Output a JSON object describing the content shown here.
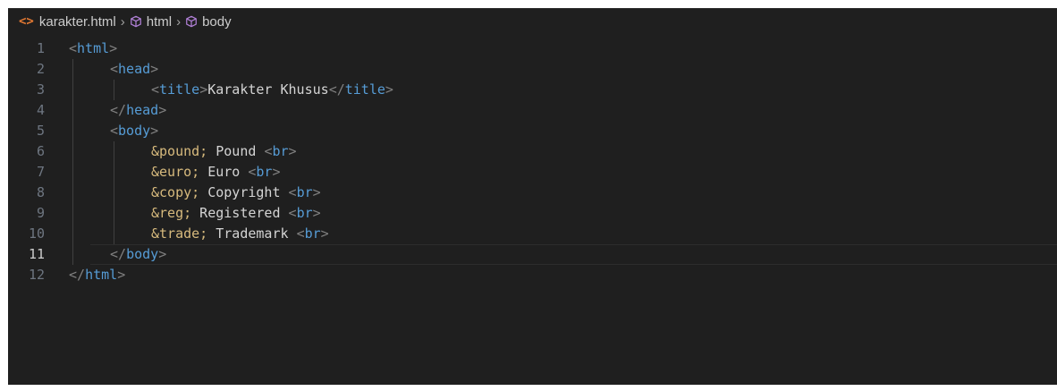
{
  "breadcrumb": {
    "file": "karakter.html",
    "items": [
      "html",
      "body"
    ]
  },
  "lines": [
    {
      "num": "1",
      "indent": 0,
      "tokens": [
        {
          "t": "<",
          "c": "bracket"
        },
        {
          "t": "html",
          "c": "tag-name"
        },
        {
          "t": ">",
          "c": "bracket"
        }
      ]
    },
    {
      "num": "2",
      "indent": 1,
      "tokens": [
        {
          "t": "<",
          "c": "bracket"
        },
        {
          "t": "head",
          "c": "tag-name"
        },
        {
          "t": ">",
          "c": "bracket"
        }
      ]
    },
    {
      "num": "3",
      "indent": 2,
      "tokens": [
        {
          "t": "<",
          "c": "bracket"
        },
        {
          "t": "title",
          "c": "tag-name"
        },
        {
          "t": ">",
          "c": "bracket"
        },
        {
          "t": "Karakter Khusus",
          "c": "plain"
        },
        {
          "t": "</",
          "c": "bracket"
        },
        {
          "t": "title",
          "c": "tag-name"
        },
        {
          "t": ">",
          "c": "bracket"
        }
      ]
    },
    {
      "num": "4",
      "indent": 1,
      "tokens": [
        {
          "t": "</",
          "c": "bracket"
        },
        {
          "t": "head",
          "c": "tag-name"
        },
        {
          "t": ">",
          "c": "bracket"
        }
      ]
    },
    {
      "num": "5",
      "indent": 1,
      "tokens": [
        {
          "t": "<",
          "c": "bracket"
        },
        {
          "t": "body",
          "c": "tag-name"
        },
        {
          "t": ">",
          "c": "bracket"
        }
      ]
    },
    {
      "num": "6",
      "indent": 2,
      "tokens": [
        {
          "t": "&pound;",
          "c": "ent"
        },
        {
          "t": " Pound ",
          "c": "plain"
        },
        {
          "t": "<",
          "c": "bracket"
        },
        {
          "t": "br",
          "c": "tag-name"
        },
        {
          "t": ">",
          "c": "bracket"
        }
      ]
    },
    {
      "num": "7",
      "indent": 2,
      "tokens": [
        {
          "t": "&euro;",
          "c": "ent"
        },
        {
          "t": " Euro ",
          "c": "plain"
        },
        {
          "t": "<",
          "c": "bracket"
        },
        {
          "t": "br",
          "c": "tag-name"
        },
        {
          "t": ">",
          "c": "bracket"
        }
      ]
    },
    {
      "num": "8",
      "indent": 2,
      "tokens": [
        {
          "t": "&copy;",
          "c": "ent"
        },
        {
          "t": " Copyright ",
          "c": "plain"
        },
        {
          "t": "<",
          "c": "bracket"
        },
        {
          "t": "br",
          "c": "tag-name"
        },
        {
          "t": ">",
          "c": "bracket"
        }
      ]
    },
    {
      "num": "9",
      "indent": 2,
      "tokens": [
        {
          "t": "&reg;",
          "c": "ent"
        },
        {
          "t": " Registered ",
          "c": "plain"
        },
        {
          "t": "<",
          "c": "bracket"
        },
        {
          "t": "br",
          "c": "tag-name"
        },
        {
          "t": ">",
          "c": "bracket"
        }
      ]
    },
    {
      "num": "10",
      "indent": 2,
      "tokens": [
        {
          "t": "&trade;",
          "c": "ent"
        },
        {
          "t": " Trademark ",
          "c": "plain"
        },
        {
          "t": "<",
          "c": "bracket"
        },
        {
          "t": "br",
          "c": "tag-name"
        },
        {
          "t": ">",
          "c": "bracket"
        }
      ]
    },
    {
      "num": "11",
      "indent": 1,
      "active": true,
      "tokens": [
        {
          "t": "</",
          "c": "bracket"
        },
        {
          "t": "body",
          "c": "tag-name"
        },
        {
          "t": ">",
          "c": "bracket"
        }
      ]
    },
    {
      "num": "12",
      "indent": 0,
      "tokens": [
        {
          "t": "</",
          "c": "bracket"
        },
        {
          "t": "html",
          "c": "tag-name"
        },
        {
          "t": ">",
          "c": "bracket"
        }
      ]
    }
  ],
  "colors": {
    "background": "#1f1f1f",
    "tag": "#569cd6",
    "entity": "#d7ba7d",
    "text": "#d4d4d4",
    "file_icon": "#e37933"
  },
  "icons": {
    "file": "html-file-icon",
    "symbol": "cube-icon"
  }
}
